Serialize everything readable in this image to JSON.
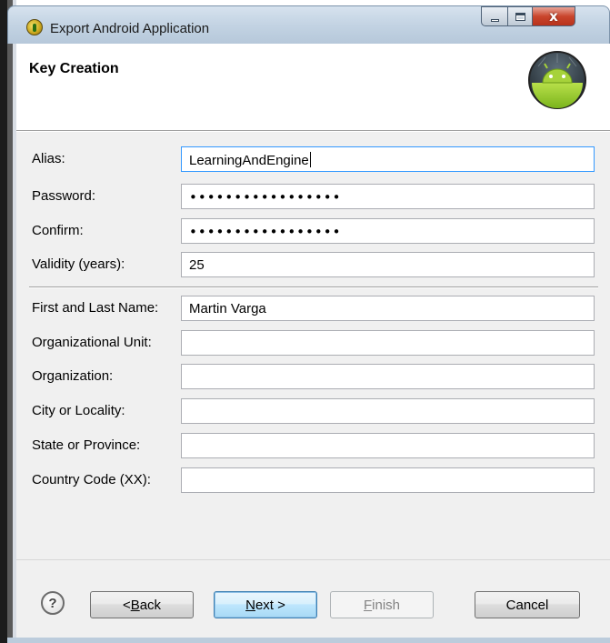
{
  "window": {
    "title": "Export Android Application",
    "close_glyph": "x"
  },
  "header": {
    "title": "Key Creation",
    "icon": "android-logo"
  },
  "form": {
    "alias": {
      "label": "Alias:",
      "value": "LearningAndEngine"
    },
    "password": {
      "label": "Password:",
      "value": "•••••••••••••••••"
    },
    "confirm": {
      "label": "Confirm:",
      "value": "•••••••••••••••••"
    },
    "validity": {
      "label": "Validity (years):",
      "value": "25"
    },
    "name": {
      "label": "First and Last Name:",
      "value": "Martin Varga"
    },
    "org_unit": {
      "label": "Organizational Unit:",
      "value": ""
    },
    "organization": {
      "label": "Organization:",
      "value": ""
    },
    "city": {
      "label": "City or Locality:",
      "value": ""
    },
    "state": {
      "label": "State or Province:",
      "value": ""
    },
    "country": {
      "label": "Country Code (XX):",
      "value": ""
    }
  },
  "footer": {
    "help_glyph": "?",
    "back": {
      "prefix": "< ",
      "mnemonic": "B",
      "rest": "ack"
    },
    "next": {
      "mnemonic": "N",
      "rest": "ext >"
    },
    "finish": {
      "mnemonic": "F",
      "rest": "inish",
      "enabled": false
    },
    "cancel": {
      "label": "Cancel"
    }
  },
  "colors": {
    "titlebar": "#c3d3e3",
    "close_button": "#c9452c",
    "content_bg": "#f0f0f0",
    "focus_border": "#3399ff"
  }
}
